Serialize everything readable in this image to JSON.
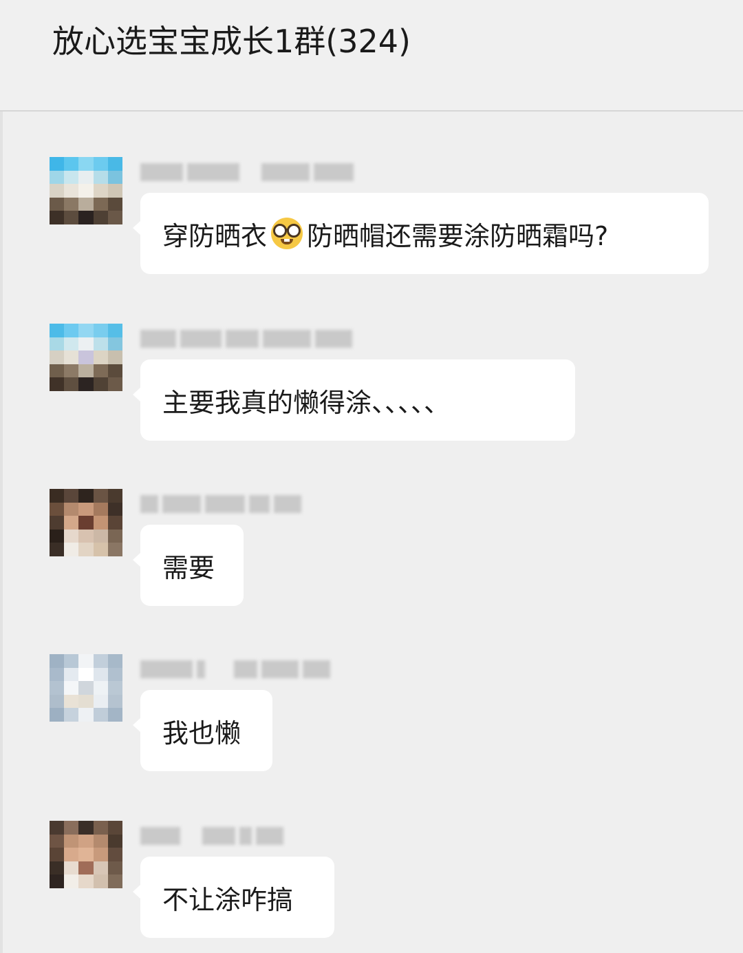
{
  "chat": {
    "title": "放心选宝宝成长1群(324)"
  },
  "messages": [
    {
      "text_before": "穿防晒衣",
      "emoji": "nerd-face-emoji",
      "text_after": "防晒帽还需要涂防晒霜吗?"
    },
    {
      "text": "主要我真的懒得涂、、、、、"
    },
    {
      "text": "需要"
    },
    {
      "text": "我也懒"
    },
    {
      "text": "不让涂咋搞"
    }
  ]
}
